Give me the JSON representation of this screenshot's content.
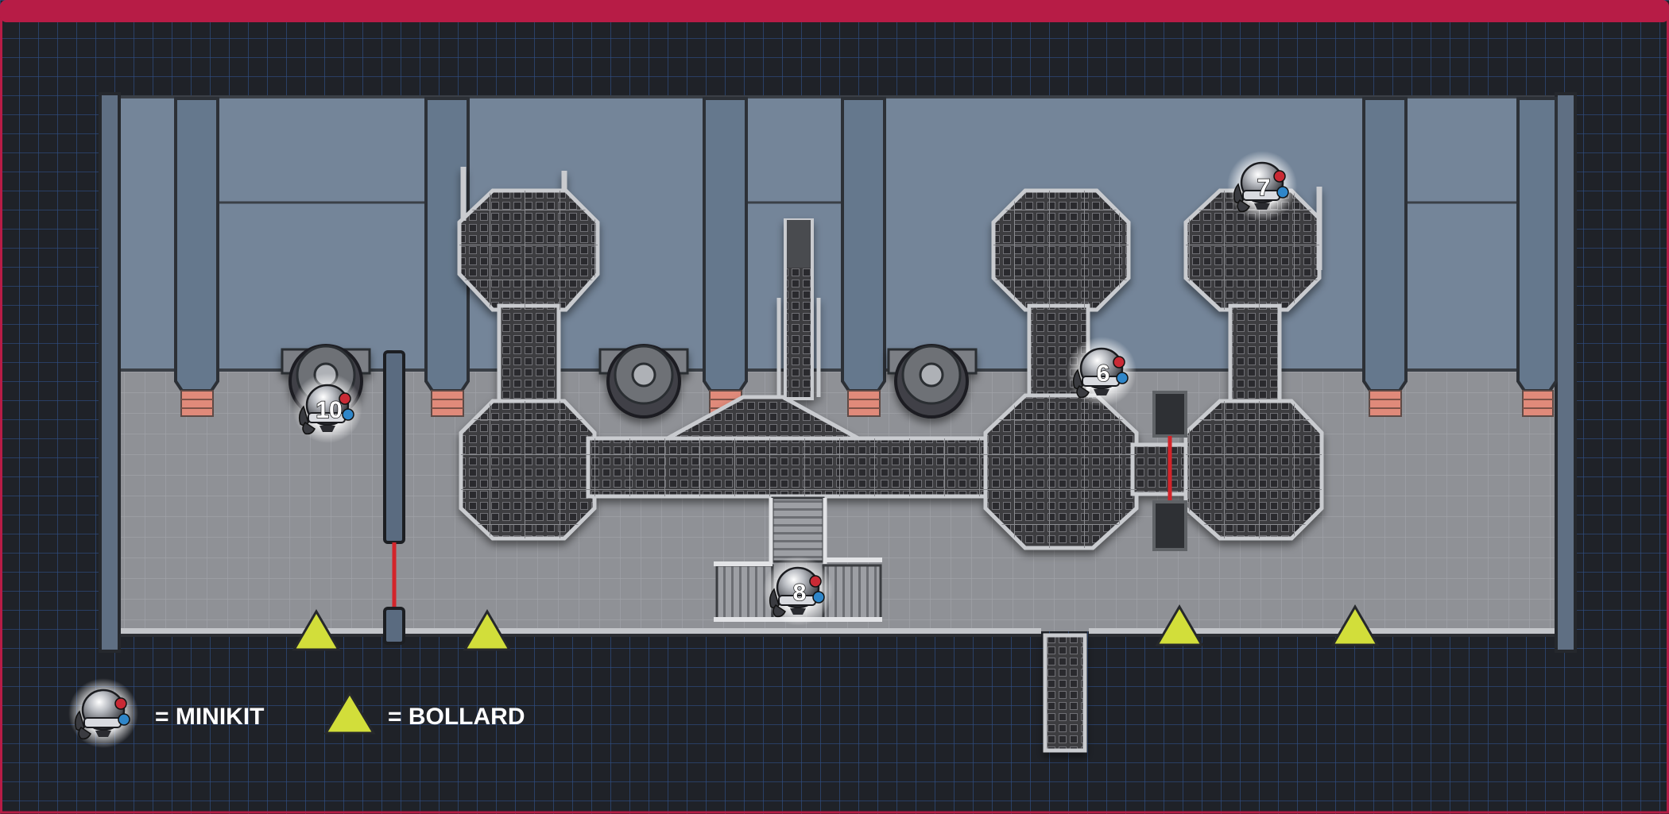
{
  "map": {
    "frame_color": "#b71c46",
    "background_color": "#1f2228",
    "grid_color": "#2f4f86",
    "wall_color": "#748599",
    "floor_color": "#8f9196",
    "grate_color": "#3c3d40",
    "laser_color": "#d3242a",
    "bollard_color": "#d2de3a"
  },
  "minikits": [
    {
      "number": "10",
      "icon": "minikit-icon"
    },
    {
      "number": "8",
      "icon": "minikit-icon"
    },
    {
      "number": "6",
      "icon": "minikit-icon"
    },
    {
      "number": "7",
      "icon": "minikit-icon"
    }
  ],
  "bollard_count": 4,
  "legend": {
    "minikit_label": "= MINIKIT",
    "bollard_label": "= BOLLARD",
    "minikit_icon": "minikit-icon",
    "bollard_icon": "triangle-icon"
  }
}
